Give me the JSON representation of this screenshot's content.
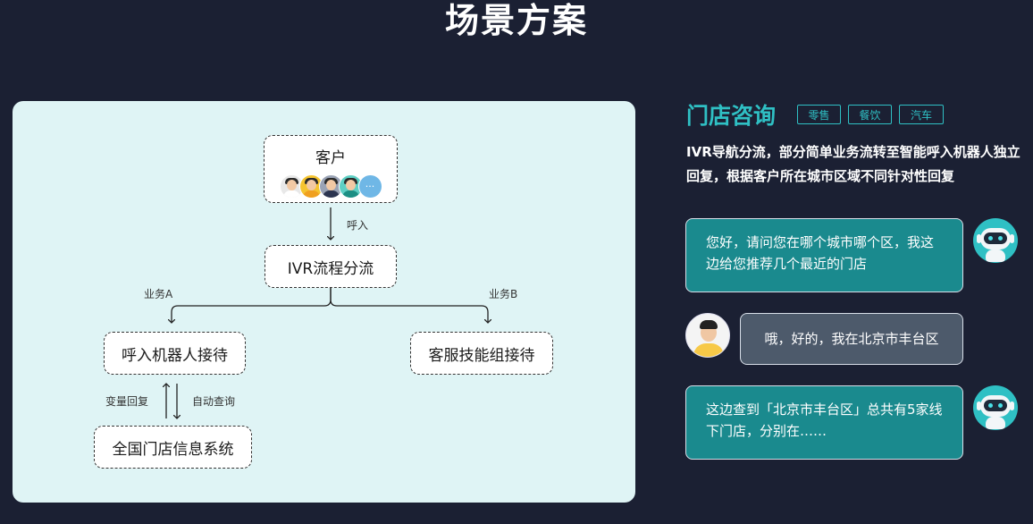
{
  "page": {
    "title": "场景方案"
  },
  "flow": {
    "customer_label": "客户",
    "avatar_more": "···",
    "call_label": "呼入",
    "ivr_label": "IVR流程分流",
    "branch_a_label": "业务A",
    "branch_b_label": "业务B",
    "robot_node_label": "呼入机器人接待",
    "agent_node_label": "客服技能组接待",
    "variable_reply_label": "变量回复",
    "auto_query_label": "自动查询",
    "store_system_label": "全国门店信息系统"
  },
  "scenario": {
    "title": "门店咨询",
    "tags": [
      "零售",
      "餐饮",
      "汽车"
    ],
    "description": "IVR导航分流，部分简单业务流转至智能呼入机器人独立回复，根据客户所在城市区域不同针对性回复"
  },
  "chat": {
    "messages": [
      {
        "role": "bot",
        "text": "您好，请问您在哪个城市哪个区，我这边给您推荐几个最近的门店"
      },
      {
        "role": "user",
        "text": "哦，好的，我在北京市丰台区"
      },
      {
        "role": "bot",
        "text": "这边查到「北京市丰台区」总共有5家线下门店，分别在……"
      }
    ]
  },
  "colors": {
    "background": "#1b2033",
    "accent": "#2fc0c4",
    "panel": "#dff4f5",
    "bot_bubble": "#1a8a8e",
    "user_bubble": "#4d5a6b"
  }
}
